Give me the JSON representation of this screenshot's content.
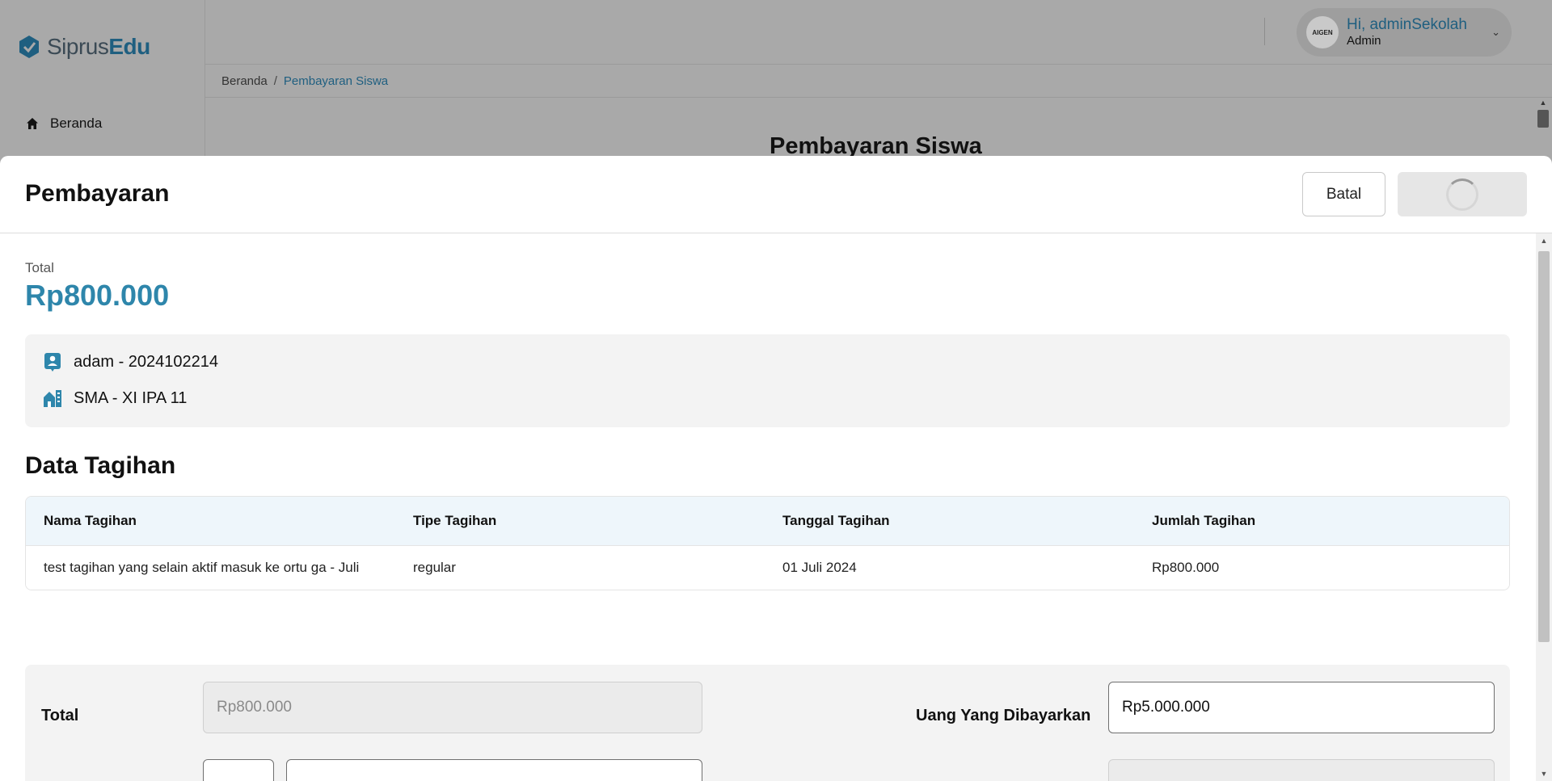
{
  "app": {
    "logo_text_primary": "Siprus",
    "logo_text_accent": "Edu",
    "avatar_text": "AIGEN",
    "user_greeting": "Hi, adminSekolah",
    "user_role": "Admin",
    "sidebar": {
      "items": [
        {
          "label": "Beranda",
          "icon": "home-icon"
        }
      ]
    },
    "breadcrumb": {
      "home": "Beranda",
      "separator": "/",
      "current": "Pembayaran Siswa"
    },
    "page_title": "Pembayaran Siswa"
  },
  "modal": {
    "title": "Pembayaran",
    "cancel_label": "Batal",
    "submit_state": "loading",
    "total_label": "Total",
    "total_value": "Rp800.000",
    "student": {
      "name_nis": "adam - 2024102214",
      "class": "SMA - XI IPA 11",
      "name_icon": "contact-card-icon",
      "class_icon": "school-building-icon"
    },
    "bills_section_title": "Data Tagihan",
    "bills_table": {
      "columns": [
        "Nama Tagihan",
        "Tipe Tagihan",
        "Tanggal Tagihan",
        "Jumlah Tagihan"
      ],
      "rows": [
        [
          "test tagihan yang selain aktif masuk ke ortu ga - Juli",
          "regular",
          "01 Juli 2024",
          "Rp800.000"
        ]
      ]
    },
    "payment": {
      "total_label": "Total",
      "total_value": "Rp800.000",
      "paid_label": "Uang Yang Dibayarkan",
      "paid_value": "Rp5.000.000"
    }
  },
  "colors": {
    "accent": "#2e86ab",
    "brand_dark": "#1f5f80",
    "overlay": "#a9a9a9",
    "table_header_bg": "#eef6fb"
  }
}
